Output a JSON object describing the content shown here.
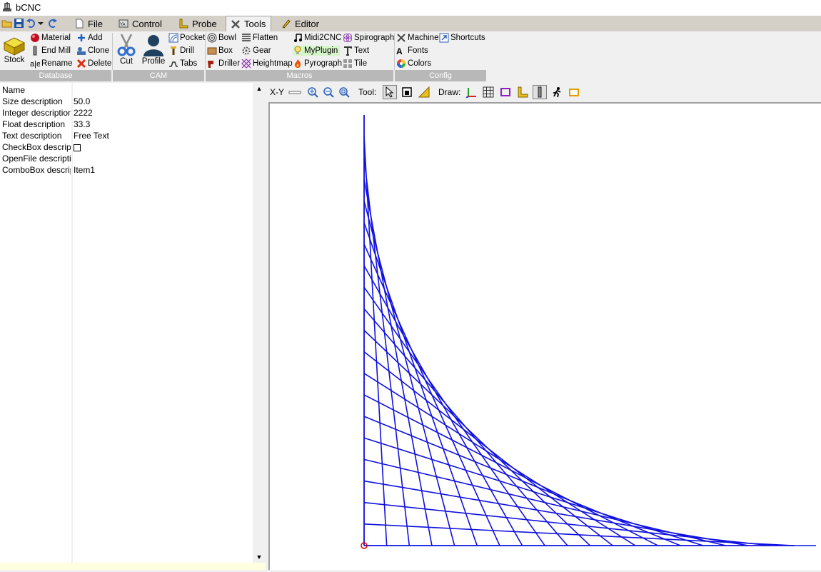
{
  "window": {
    "title": "bCNC"
  },
  "tabs": [
    {
      "label": "File",
      "icon": "file-icon"
    },
    {
      "label": "Control",
      "icon": "control-icon"
    },
    {
      "label": "Probe",
      "icon": "probe-icon"
    },
    {
      "label": "Tools",
      "icon": "tools-icon",
      "active": true
    },
    {
      "label": "Editor",
      "icon": "editor-icon"
    }
  ],
  "ribbon": {
    "database": {
      "label": "Database",
      "stock": "Stock",
      "material": "Material",
      "end_mill": "End Mill",
      "rename": "Rename",
      "add": "Add",
      "clone": "Clone",
      "delete": "Delete"
    },
    "cam": {
      "label": "CAM",
      "cut": "Cut",
      "profile": "Profile",
      "pocket": "Pocket",
      "drill": "Drill",
      "tabs": "Tabs"
    },
    "macros": {
      "label": "Macros",
      "bowl": "Bowl",
      "flatten": "Flatten",
      "midi2cnc": "Midi2CNC",
      "spirograph": "Spirograph",
      "box": "Box",
      "gear": "Gear",
      "myplugin": "MyPlugin",
      "text": "Text",
      "driller": "Driller",
      "heightmap": "Heightmap",
      "pyrograph": "Pyrograph",
      "tile": "Tile"
    },
    "config": {
      "label": "Config",
      "machine": "Machine",
      "shortcuts": "Shortcuts",
      "fonts": "Fonts",
      "colors": "Colors"
    }
  },
  "properties": [
    {
      "key": "Name",
      "value": ""
    },
    {
      "key": "Size description",
      "value": "50.0"
    },
    {
      "key": "Integer description",
      "value": "2222"
    },
    {
      "key": "Float description",
      "value": "33.3"
    },
    {
      "key": "Text description",
      "value": "Free Text"
    },
    {
      "key": "CheckBox description",
      "value": "",
      "checkbox": true
    },
    {
      "key": "OpenFile description",
      "value": ""
    },
    {
      "key": "ComboBox description",
      "value": "Item1"
    }
  ],
  "canvas_toolbar": {
    "view": "X-Y",
    "tool_label": "Tool:",
    "draw_label": "Draw:"
  },
  "colors": {
    "path": "#1010e0",
    "origin": "#e00000"
  }
}
